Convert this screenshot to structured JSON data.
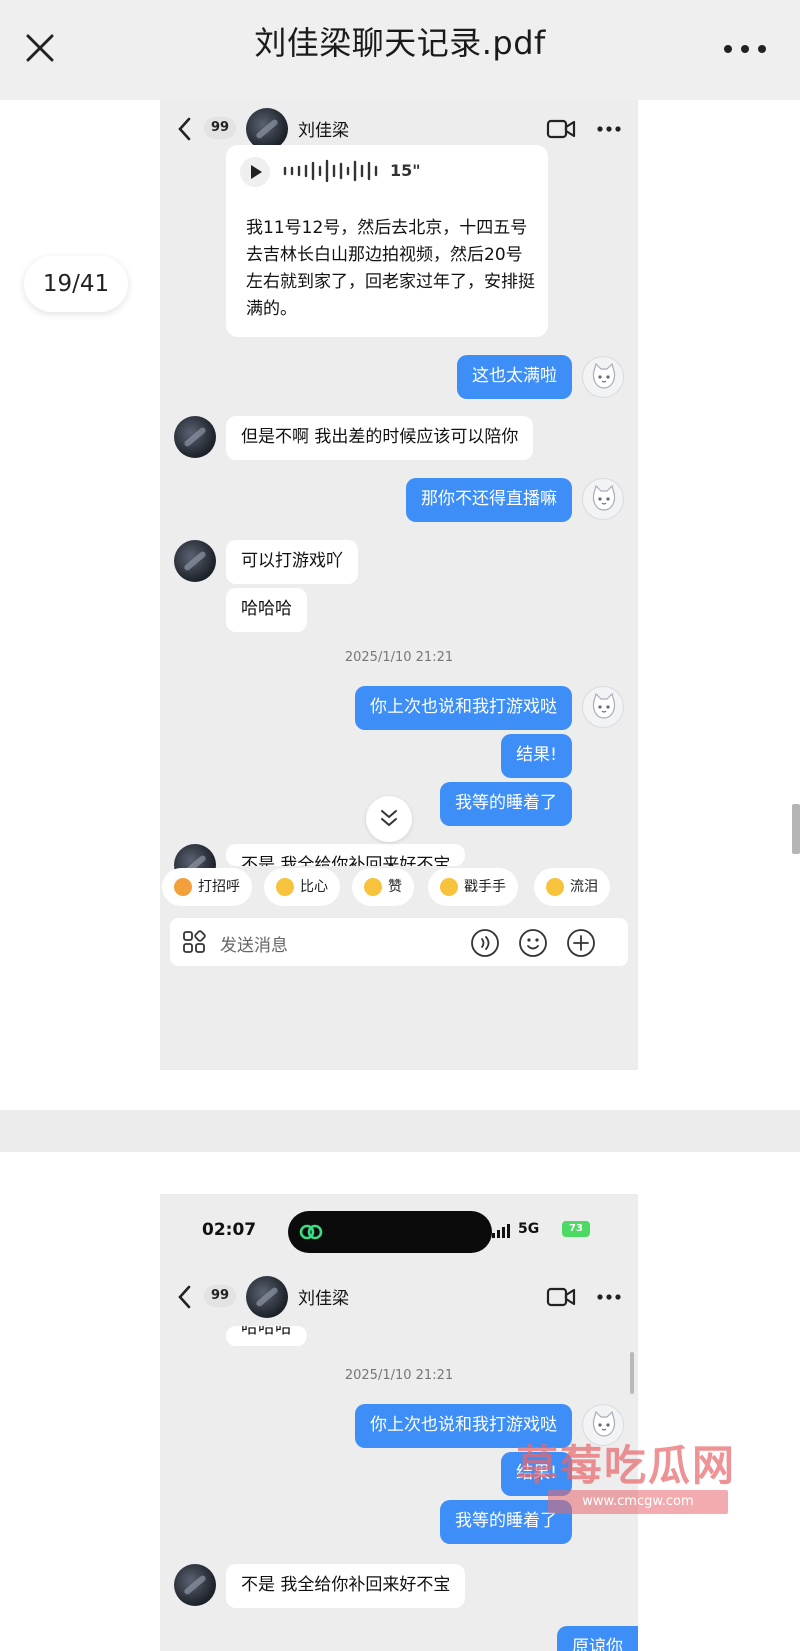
{
  "viewer": {
    "title": "刘佳梁聊天记录.pdf",
    "page_indicator": "19/41"
  },
  "chat": {
    "contact_name": "刘佳梁",
    "unread_count": "99",
    "voice_duration": "15\"",
    "voice_transcript": "我11号12号，然后去北京，十四五号去吉林长白山那边拍视频，然后20号左右就到家了，回老家过年了，安排挺满的。",
    "input_placeholder": "发送消息"
  },
  "page1_messages": [
    {
      "side": "out",
      "text": "这也太满啦"
    },
    {
      "side": "in",
      "text": "但是不啊 我出差的时候应该可以陪你"
    },
    {
      "side": "out",
      "text": "那你不还得直播嘛"
    },
    {
      "side": "in",
      "text": "可以打游戏吖"
    },
    {
      "side": "in",
      "text": "哈哈哈"
    },
    {
      "side": "time",
      "text": "2025/1/10 21:21"
    },
    {
      "side": "out",
      "text": "你上次也说和我打游戏哒"
    },
    {
      "side": "out",
      "text": "结果!"
    },
    {
      "side": "out",
      "text": "我等的睡着了"
    },
    {
      "side": "in",
      "text": "不是 我全给你补回来好不宝"
    }
  ],
  "quick_replies": [
    "打招呼",
    "比心",
    "赞",
    "戳手手",
    "流泪"
  ],
  "page2": {
    "status_time": "02:07",
    "network": "5G",
    "battery": "73",
    "partial_top": "哈哈哈",
    "timestamp": "2025/1/10 21:21",
    "messages": [
      {
        "side": "out",
        "text": "你上次也说和我打游戏哒"
      },
      {
        "side": "out",
        "text": "结果!"
      },
      {
        "side": "out",
        "text": "我等的睡着了"
      },
      {
        "side": "in",
        "text": "不是 我全给你补回来好不宝"
      },
      {
        "side": "out",
        "text": "原谅你"
      }
    ]
  },
  "watermark": {
    "main": "草莓吃瓜网",
    "sub": "www.cmcgw.com"
  },
  "colors": {
    "accent_blue": "#3d8ef7",
    "chat_background": "#ededed",
    "watermark_red": "#e8686e"
  }
}
